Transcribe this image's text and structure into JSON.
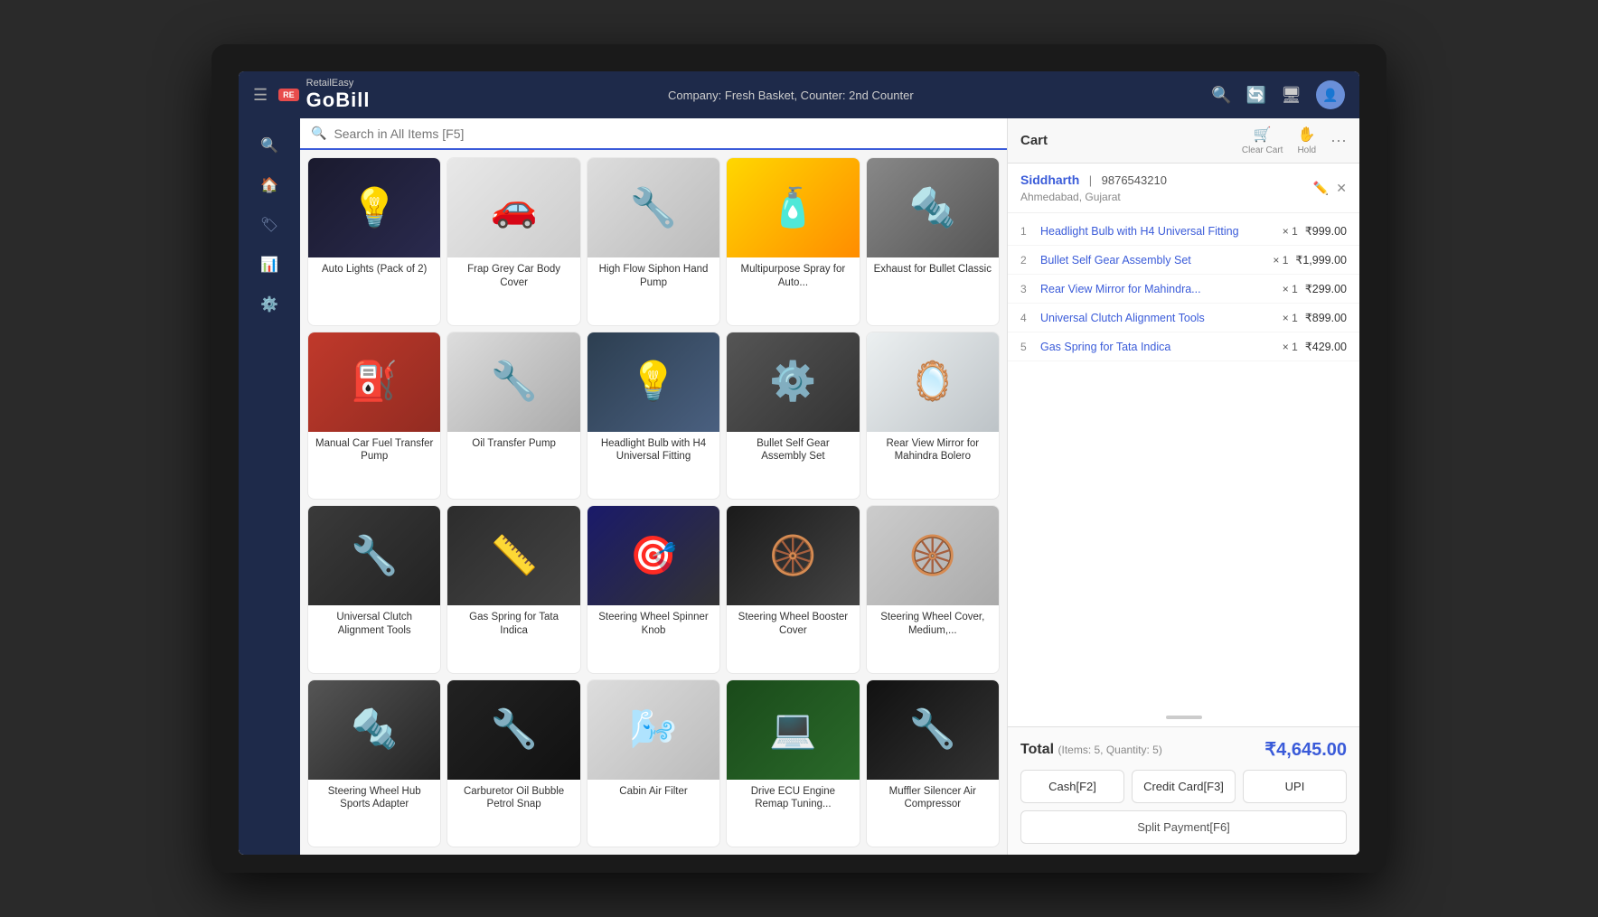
{
  "app": {
    "name": "GoBill",
    "brand": "RetailEasy",
    "logo_badge": "RE",
    "company_info": "Company: Fresh Basket,  Counter: 2nd Counter"
  },
  "topbar": {
    "search_placeholder": "Search in All Items [F5]",
    "cart_label": "Cart",
    "clear_cart": "Clear Cart",
    "hold_label": "Hold"
  },
  "customer": {
    "name": "Siddharth",
    "phone": "9876543210",
    "location": "Ahmedabad, Gujarat"
  },
  "cart_items": [
    {
      "num": "1",
      "name": "Headlight Bulb with H4 Universal Fitting",
      "qty": "× 1",
      "price": "₹999.00"
    },
    {
      "num": "2",
      "name": "Bullet Self Gear Assembly Set",
      "qty": "× 1",
      "price": "₹1,999.00"
    },
    {
      "num": "3",
      "name": "Rear View Mirror for Mahindra...",
      "qty": "× 1",
      "price": "₹299.00"
    },
    {
      "num": "4",
      "name": "Universal Clutch Alignment Tools",
      "qty": "× 1",
      "price": "₹899.00"
    },
    {
      "num": "5",
      "name": "Gas Spring for Tata Indica",
      "qty": "× 1",
      "price": "₹429.00"
    }
  ],
  "total": {
    "label": "Total",
    "sub": "(Items: 5, Quantity: 5)",
    "amount": "₹4,645.00"
  },
  "payment_buttons": [
    {
      "label": "Cash[F2]",
      "key": "cash"
    },
    {
      "label": "Credit Card[F3]",
      "key": "credit"
    },
    {
      "label": "UPI",
      "key": "upi"
    }
  ],
  "split_button": "Split Payment[F6]",
  "products": [
    {
      "id": "auto-lights",
      "name": "Auto Lights (Pack of 2)",
      "bg": "prod-auto-lights",
      "icon": "💡"
    },
    {
      "id": "car-cover",
      "name": "Frap Grey Car Body Cover",
      "bg": "prod-car-cover",
      "icon": "🚗"
    },
    {
      "id": "siphon",
      "name": "High Flow Siphon Hand Pump",
      "bg": "prod-siphon",
      "icon": "🔧"
    },
    {
      "id": "wd40",
      "name": "Multipurpose Spray for Auto...",
      "bg": "prod-wd40",
      "icon": "🧴"
    },
    {
      "id": "exhaust",
      "name": "Exhaust for Bullet Classic",
      "bg": "prod-exhaust",
      "icon": "🔩"
    },
    {
      "id": "fuel-pump",
      "name": "Manual Car Fuel Transfer Pump",
      "bg": "prod-fuel-pump",
      "icon": "⛽"
    },
    {
      "id": "oil-pump",
      "name": "Oil Transfer Pump",
      "bg": "prod-oil-pump",
      "icon": "🔧"
    },
    {
      "id": "headlight",
      "name": "Headlight Bulb with H4 Universal Fitting",
      "bg": "prod-headlight",
      "icon": "💡"
    },
    {
      "id": "gear",
      "name": "Bullet Self Gear Assembly Set",
      "bg": "prod-gear",
      "icon": "⚙️"
    },
    {
      "id": "mirror",
      "name": "Rear View Mirror for Mahindra Bolero",
      "bg": "prod-mirror",
      "icon": "🪞"
    },
    {
      "id": "clutch",
      "name": "Universal Clutch Alignment Tools",
      "bg": "prod-clutch",
      "icon": "🔧"
    },
    {
      "id": "gas-spring",
      "name": "Gas Spring for Tata Indica",
      "bg": "prod-gas-spring",
      "icon": "📏"
    },
    {
      "id": "spinner",
      "name": "Steering Wheel Spinner Knob",
      "bg": "prod-spinner",
      "icon": "🎯"
    },
    {
      "id": "booster",
      "name": "Steering Wheel Booster Cover",
      "bg": "prod-booster",
      "icon": "🛞"
    },
    {
      "id": "wheel-cover",
      "name": "Steering Wheel Cover, Medium,...",
      "bg": "prod-wheel-cover",
      "icon": "🛞"
    },
    {
      "id": "hub",
      "name": "Steering Wheel Hub Sports Adapter",
      "bg": "prod-hub",
      "icon": "🔩"
    },
    {
      "id": "carb",
      "name": "Carburetor Oil Bubble Petrol Snap",
      "bg": "prod-carb",
      "icon": "🔧"
    },
    {
      "id": "cabin",
      "name": "Cabin Air Filter",
      "bg": "prod-cabin",
      "icon": "🌬️"
    },
    {
      "id": "ecu",
      "name": "Drive ECU Engine Remap Tuning...",
      "bg": "prod-ecu",
      "icon": "💻"
    },
    {
      "id": "muffler",
      "name": "Muffler Silencer Air Compressor",
      "bg": "prod-muffler",
      "icon": "🔧"
    }
  ]
}
